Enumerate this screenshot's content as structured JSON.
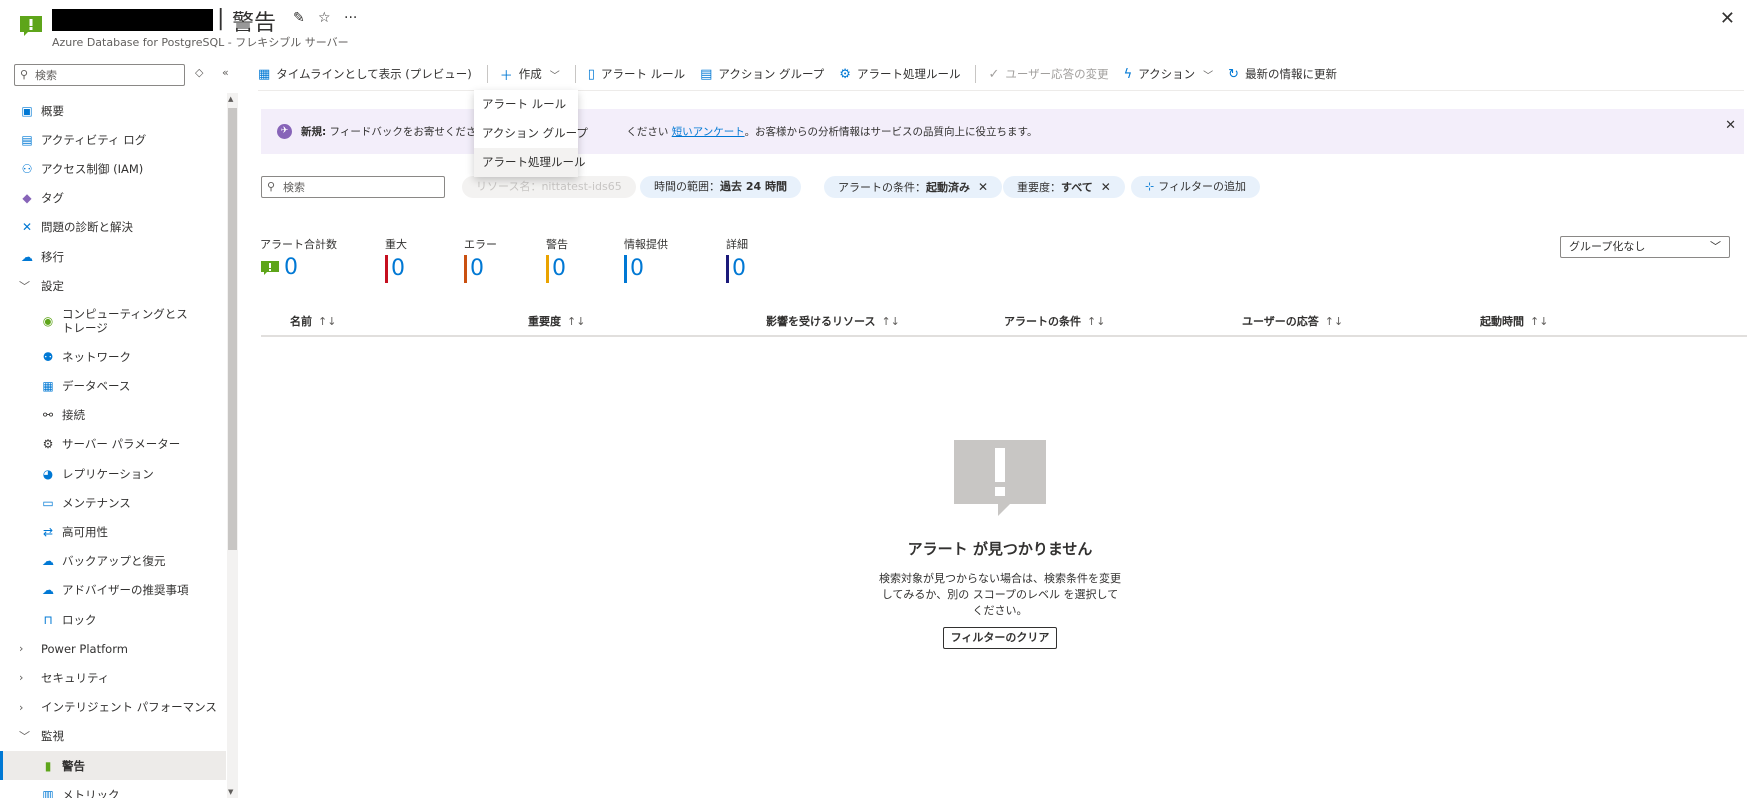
{
  "header": {
    "title": "警告",
    "subtitle": "Azure Database for PostgreSQL - フレキシブル サーバー",
    "separator": "|"
  },
  "sidebar": {
    "search_placeholder": "検索",
    "items": [
      {
        "label": "概要"
      },
      {
        "label": "アクティビティ ログ"
      },
      {
        "label": "アクセス制御 (IAM)"
      },
      {
        "label": "タグ"
      },
      {
        "label": "問題の診断と解決"
      },
      {
        "label": "移行"
      },
      {
        "label": "設定"
      },
      {
        "label": "コンピューティングとストレージ"
      },
      {
        "label": "ネットワーク"
      },
      {
        "label": "データベース"
      },
      {
        "label": "接続"
      },
      {
        "label": "サーバー パラメーター"
      },
      {
        "label": "レプリケーション"
      },
      {
        "label": "メンテナンス"
      },
      {
        "label": "高可用性"
      },
      {
        "label": "バックアップと復元"
      },
      {
        "label": "アドバイザーの推奨事項"
      },
      {
        "label": "ロック"
      },
      {
        "label": "Power Platform"
      },
      {
        "label": "セキュリティ"
      },
      {
        "label": "インテリジェント パフォーマンス"
      },
      {
        "label": "監視"
      },
      {
        "label": "警告"
      },
      {
        "label": "メトリック"
      }
    ]
  },
  "toolbar": {
    "timeline": "タイムラインとして表示 (プレビュー)",
    "create": "作成",
    "alert_rules": "アラート ルール",
    "action_groups": "アクション グループ",
    "processing_rules": "アラート処理ルール",
    "change_user_response": "ユーザー応答の変更",
    "actions": "アクション",
    "refresh": "最新の情報に更新"
  },
  "create_menu": {
    "items": [
      "アラート ルール",
      "アクション グループ",
      "アラート処理ルール"
    ]
  },
  "banner": {
    "bold": "新規:",
    "text1": "フィードバックをお寄せください。完了",
    "text2": "ください",
    "link": "短いアンケート",
    "text3": "。お客様からの分析情報はサービスの品質向上に役立ちます。"
  },
  "filters": {
    "search_placeholder": "検索",
    "resource_name": "リソース名：nittatest-ids65",
    "time_range_label": "時間の範囲：",
    "time_range_value": "過去 24 時間",
    "condition_label": "アラートの条件：",
    "condition_value": "起動済み",
    "severity_label": "重要度：",
    "severity_value": "すべて",
    "add_filter": "フィルターの追加"
  },
  "summary": {
    "total": {
      "label": "アラート合計数",
      "value": "0"
    },
    "critical": {
      "label": "重大",
      "value": "0",
      "color": "#c50f1f"
    },
    "error": {
      "label": "エラー",
      "value": "0",
      "color": "#ca5010"
    },
    "warning": {
      "label": "警告",
      "value": "0",
      "color": "#eaa300"
    },
    "informational": {
      "label": "情報提供",
      "value": "0",
      "color": "#0078d4"
    },
    "verbose": {
      "label": "詳細",
      "value": "0",
      "color": "#1b1a7a"
    },
    "group_by": "グループ化なし"
  },
  "table": {
    "columns": [
      "名前",
      "重要度",
      "影響を受けるリソース",
      "アラートの条件",
      "ユーザーの応答",
      "起動時間"
    ],
    "sort_glyph": "↑↓"
  },
  "empty_state": {
    "title": "アラート が見つかりません",
    "description": "検索対象が見つからない場合は、検索条件を変更してみるか、別の スコープのレベル を選択してください。",
    "button": "フィルターのクリア"
  }
}
